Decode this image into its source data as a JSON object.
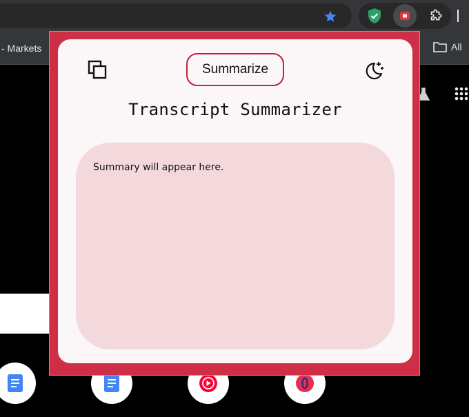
{
  "bookmarks": {
    "markets_label": "- Markets",
    "all_label": "All"
  },
  "popup": {
    "summarize_label": "Summarize",
    "title": "Transcript Summarizer",
    "summary_placeholder": "Summary will appear here."
  },
  "colors": {
    "popup_border": "#cf2e47",
    "card_background": "#fbf6f7",
    "summary_background": "#f4d9dc",
    "button_border": "#c51f3a"
  },
  "icons": {
    "copy": "copy-icon",
    "theme": "moon-stars-icon",
    "star": "bookmark-star-icon",
    "shield": "shield-check-icon",
    "youtube": "youtube-summarizer-icon",
    "extensions": "puzzle-icon"
  }
}
